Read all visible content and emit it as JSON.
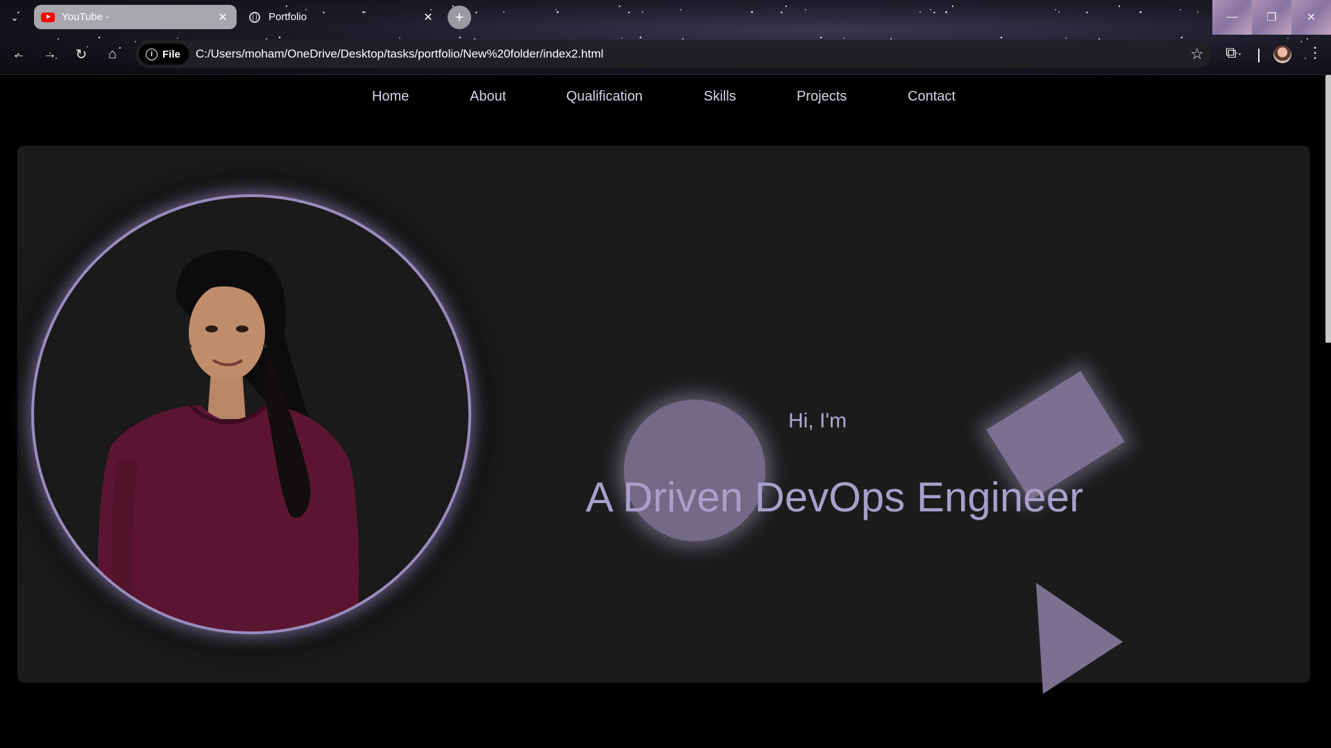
{
  "browser": {
    "tabs": [
      {
        "label": "YouTube -",
        "icon": "youtube-icon",
        "active": false
      },
      {
        "label": "Portfolio",
        "icon": "globe-icon",
        "active": true
      }
    ],
    "new_tab_label": "+",
    "address_chip": "File",
    "url": "C:/Users/moham/OneDrive/Desktop/tasks/portfolio/New%20folder/index2.html"
  },
  "site": {
    "nav": [
      "Home",
      "About",
      "Qualification",
      "Skills",
      "Projects",
      "Contact"
    ],
    "greeting": "Hi, I'm",
    "tagline": "A Driven DevOps Engineer",
    "accent_color": "#a99fcb",
    "background_color": "#1b1b1b",
    "shape_color": "#7a7190"
  }
}
